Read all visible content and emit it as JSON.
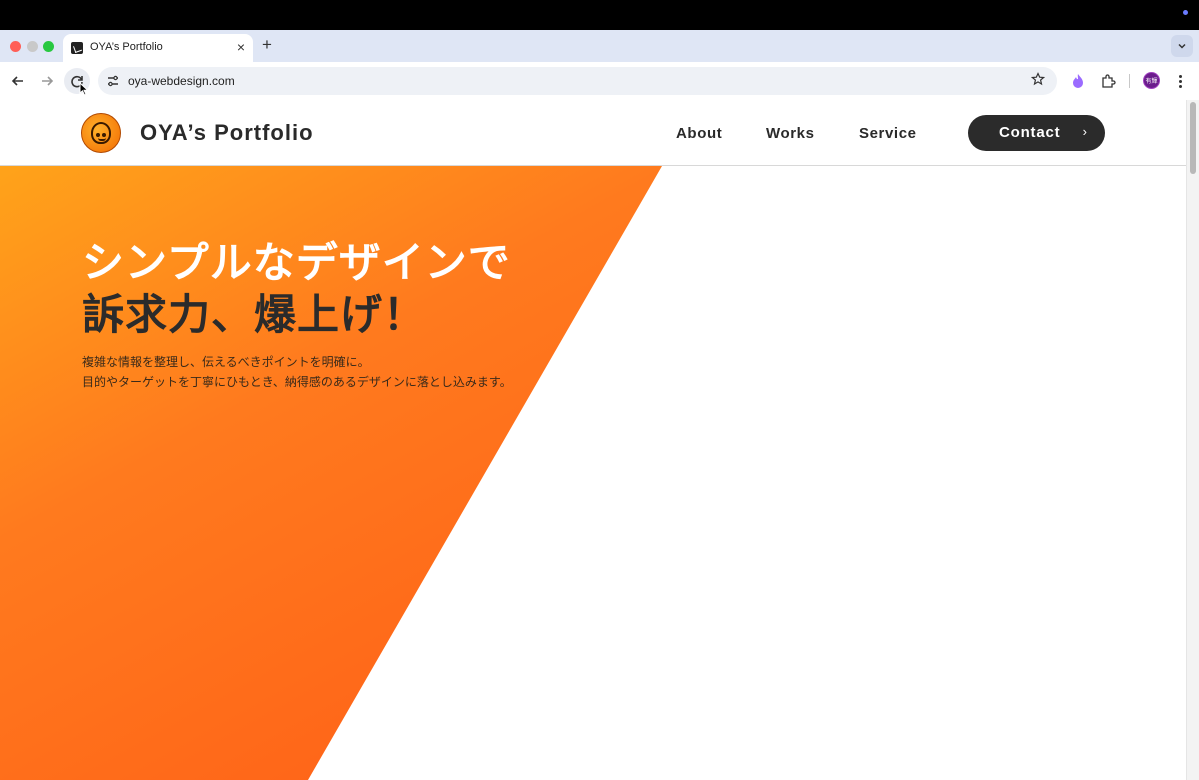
{
  "browser": {
    "tab_title": "OYA’s Portfolio",
    "tab_close": "×",
    "new_tab": "+",
    "url": "oya-webdesign.com",
    "profile_initials": "有輝"
  },
  "site": {
    "title": "OYA’s Portfolio",
    "nav": {
      "about": "About",
      "works": "Works",
      "service": "Service",
      "contact": "Contact",
      "contact_chevron": "›"
    },
    "hero": {
      "headline_line1": "シンプルなデザインで",
      "headline_line2": "訴求力、爆上げ！",
      "subtext_line1": "複雑な情報を整理し、伝えるべきポイントを明確に。",
      "subtext_line2": "目的やターゲットを丁寧にひもとき、納得感のあるデザインに落とし込みます。"
    }
  },
  "colors": {
    "accent_orange": "#ff6b1a",
    "accent_yellow": "#ffa31a",
    "dark": "#2b2b2b"
  },
  "icons": [
    "back-arrow-icon",
    "forward-arrow-icon",
    "reload-icon",
    "site-settings-icon",
    "bookmark-star-icon",
    "extension-puzzle-icon",
    "kebab-menu-icon",
    "chevron-down-icon"
  ]
}
